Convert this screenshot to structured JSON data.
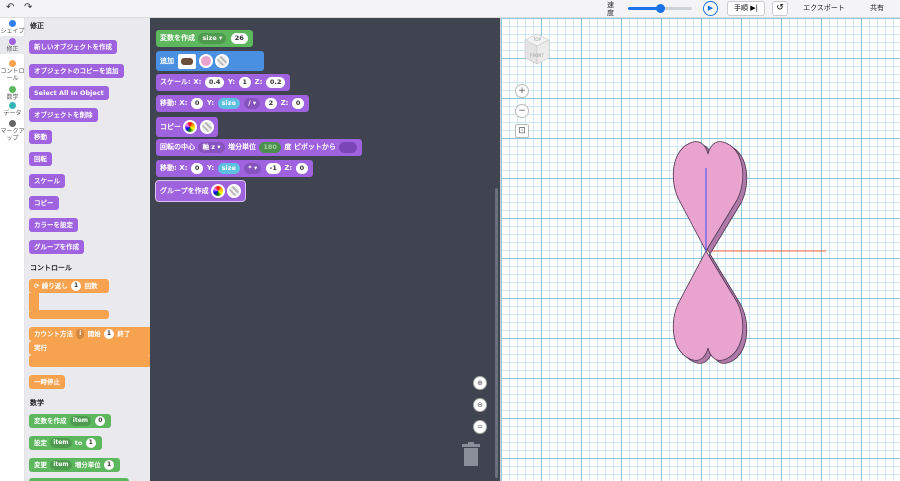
{
  "toolbar": {
    "undo_icon": "undo-arrow",
    "redo_icon": "redo-arrow",
    "speed_label": "速度",
    "speed_value": 0.5,
    "play_icon": "play",
    "step_label": "手順",
    "step_icon": "step-forward",
    "reset_icon": "reset",
    "export_label": "エクスポート",
    "share_label": "共有"
  },
  "categories": [
    {
      "label": "シェイプ",
      "color": "#2f80ed"
    },
    {
      "label": "修正",
      "color": "#9f63e0"
    },
    {
      "label": "コントロール",
      "color": "#f6a24e"
    },
    {
      "label": "数学",
      "color": "#5cb75d"
    },
    {
      "label": "データ",
      "color": "#33b5b5"
    },
    {
      "label": "マークアップ",
      "color": "#666666"
    }
  ],
  "flyout": {
    "modify_header": "修正",
    "modify_blocks": [
      "新しいオブジェクトを作成",
      "オブジェクトのコピーを追加",
      "Select All In Object",
      "オブジェクトを削除",
      "移動",
      "回転",
      "スケール",
      "コピー",
      "カラーを設定",
      "グループを作成"
    ],
    "control_header": "コントロール",
    "repeat_block": {
      "label": "繰り返し",
      "count": "1",
      "suffix": "回数"
    },
    "count_block": {
      "label": "カウント方法",
      "var": "i",
      "start_label": "開始",
      "start": "1",
      "end_label": "終了",
      "do_label": "実行"
    },
    "pause_block": "一時停止",
    "math_header": "数学",
    "math_blocks": [
      {
        "label": "変数を作成",
        "var": "item",
        "value": "0"
      },
      {
        "label": "設定",
        "var": "item",
        "to": "to",
        "value": "1"
      },
      {
        "label": "変更",
        "var": "item",
        "by": "増分単位",
        "value": "1"
      }
    ]
  },
  "workspace": {
    "create_var": {
      "label": "変数を作成",
      "var": "size",
      "value": "26"
    },
    "add": {
      "label": "追加"
    },
    "scale": {
      "label": "スケール:",
      "x_label": "X:",
      "x": "0.4",
      "y_label": "Y:",
      "y": "1",
      "z_label": "Z:",
      "z": "0.2"
    },
    "move1": {
      "label": "移動:",
      "x_label": "X:",
      "x": "0",
      "y_label": "Y:",
      "y_var": "size",
      "op": "/",
      "y_num": "2",
      "z_label": "Z:",
      "z": "0"
    },
    "copy": {
      "label": "コピー"
    },
    "rotate": {
      "label": "回転の中心",
      "axis": "軸 z",
      "by_label": "増分単位",
      "angle": "180",
      "deg": "度",
      "pivot": "ピボットから"
    },
    "move2": {
      "label": "移動:",
      "x_label": "X:",
      "x": "0",
      "y_label": "Y:",
      "y_var": "size",
      "op": "*",
      "y_num": "-1",
      "z_label": "Z:",
      "z": "0"
    },
    "group": {
      "label": "グループを作成"
    }
  },
  "viewport": {
    "cube_top": "TOP",
    "cube_front": "FRONT",
    "zoom_in": "+",
    "zoom_out": "−",
    "fit": "⊡",
    "shape_color": "#e8a3cf",
    "shape_side_color": "#b07aa8"
  }
}
